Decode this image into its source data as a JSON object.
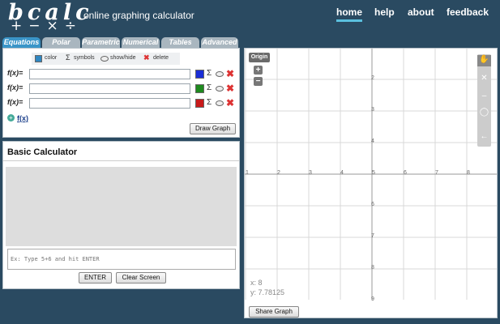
{
  "header": {
    "logo_letters": "bcalc",
    "logo_operators": "+−×÷",
    "tagline": "online graphing calculator",
    "nav": [
      {
        "label": "home",
        "active": true
      },
      {
        "label": "help",
        "active": false
      },
      {
        "label": "about",
        "active": false
      },
      {
        "label": "feedback",
        "active": false
      }
    ]
  },
  "tabs": [
    "Equations",
    "Polar",
    "Parametric",
    "Numerical",
    "Tables",
    "Advanced"
  ],
  "toolbar": {
    "color_label": "color",
    "symbols_label": "symbols",
    "showhide_label": "show/hide",
    "delete_label": "delete"
  },
  "equations": [
    {
      "label": "f(x)=",
      "value": "",
      "color": "#1a2ed6"
    },
    {
      "label": "f(x)=",
      "value": "",
      "color": "#1e8a1e"
    },
    {
      "label": "f(x)=",
      "value": "",
      "color": "#c81a1a"
    }
  ],
  "icons": {
    "sigma": "Σ",
    "delete": "✖",
    "add": "+"
  },
  "add_function_label": "f(x)",
  "draw_graph_label": "Draw Graph",
  "calculator": {
    "title": "Basic Calculator",
    "input_placeholder": "Ex: Type 5+6 and hit ENTER",
    "enter_label": "ENTER",
    "clear_label": "Clear Screen"
  },
  "graph": {
    "origin_label": "Origin",
    "zoom_in": "+",
    "zoom_out": "−",
    "x_ticks": [
      "1",
      "2",
      "3",
      "4",
      "5",
      "6",
      "7",
      "8"
    ],
    "y_ticks_top": [
      "2",
      "3",
      "4"
    ],
    "y_ticks_bottom": [
      "6",
      "7",
      "8",
      "9"
    ],
    "coord_x": "x: 8",
    "coord_y": "y: 7.78125",
    "share_label": "Share Graph"
  }
}
